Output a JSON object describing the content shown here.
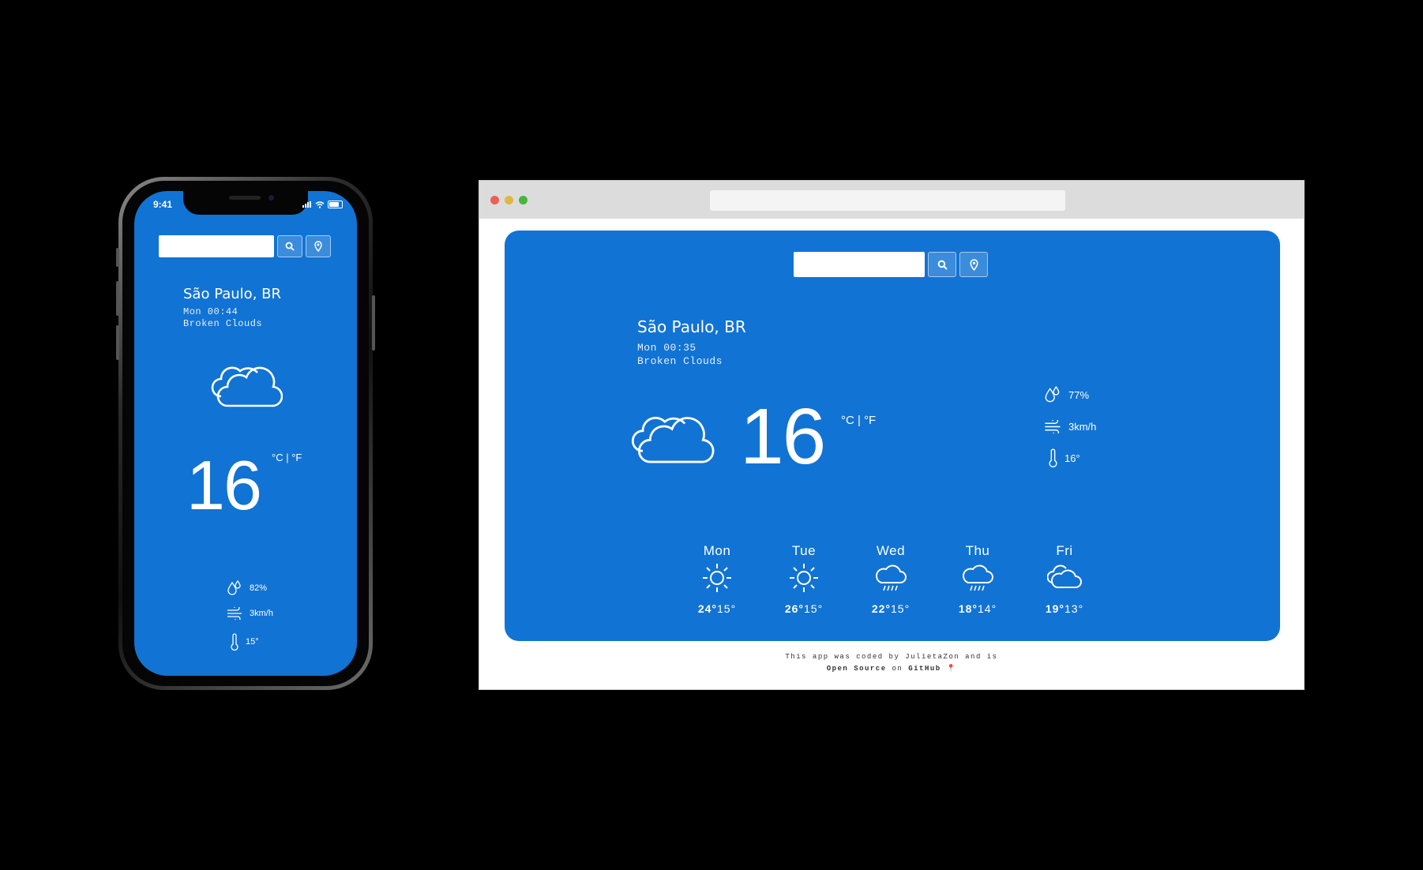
{
  "phone": {
    "status_time": "9:41",
    "search_placeholder": "",
    "city": "São Paulo, BR",
    "datetime": "Mon 00:44",
    "condition": "Broken Clouds",
    "temperature": "16",
    "units": "°C | °F",
    "humidity": "82%",
    "wind": "3km/h",
    "feels_like": "15°"
  },
  "browser": {
    "search_placeholder": "",
    "city": "São Paulo, BR",
    "datetime": "Mon 00:35",
    "condition": "Broken Clouds",
    "temperature": "16",
    "units": "°C | °F",
    "humidity": "77%",
    "wind": "3km/h",
    "feels_like": "16°",
    "forecast": [
      {
        "day": "Mon",
        "icon": "sun-icon",
        "max": "24°",
        "min": "15°"
      },
      {
        "day": "Tue",
        "icon": "sun-icon",
        "max": "26°",
        "min": "15°"
      },
      {
        "day": "Wed",
        "icon": "rain-cloud-icon",
        "max": "22°",
        "min": "15°"
      },
      {
        "day": "Thu",
        "icon": "rain-cloud-icon",
        "max": "18°",
        "min": "14°"
      },
      {
        "day": "Fri",
        "icon": "cloud-icon",
        "max": "19°",
        "min": "13°"
      }
    ],
    "footer": {
      "line1": "This app was coded by JulietaZon and is",
      "open_source": "Open Source",
      "on": "on",
      "github": "GitHub",
      "pin": "📍"
    }
  },
  "colors": {
    "app_blue": "#1173d4",
    "background": "#000000",
    "traffic_red": "#ec5f57",
    "traffic_yellow": "#e0b83f",
    "traffic_green": "#46b73c"
  }
}
